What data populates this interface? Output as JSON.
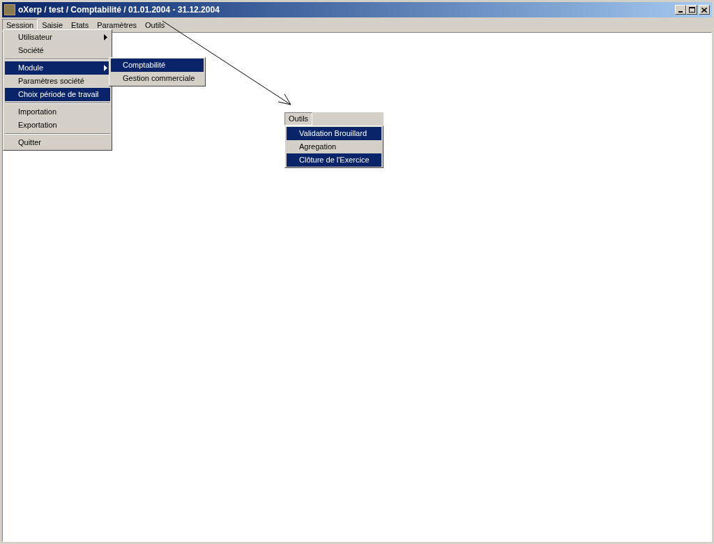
{
  "window": {
    "title": "oXerp / test / Comptabilité / 01.01.2004 - 31.12.2004"
  },
  "menu_bar": [
    {
      "label": "Session",
      "selected": true
    },
    {
      "label": "Saisie",
      "selected": false
    },
    {
      "label": "Etats",
      "selected": false
    },
    {
      "label": "Paramètres",
      "selected": false
    },
    {
      "label": "Outils",
      "selected": false
    }
  ],
  "session_menu": [
    {
      "kind": "item",
      "label": "Utilisateur",
      "has_submenu": true,
      "selected": false
    },
    {
      "kind": "item",
      "label": "Société",
      "has_submenu": false,
      "selected": false
    },
    {
      "kind": "separator"
    },
    {
      "kind": "item",
      "label": "Module",
      "has_submenu": true,
      "selected": true
    },
    {
      "kind": "item",
      "label": "Paramètres société",
      "has_submenu": false,
      "selected": false
    },
    {
      "kind": "item",
      "label": "Choix période de travail",
      "has_submenu": false,
      "selected": true
    },
    {
      "kind": "separator"
    },
    {
      "kind": "item",
      "label": "Importation",
      "has_submenu": false,
      "selected": false
    },
    {
      "kind": "item",
      "label": "Exportation",
      "has_submenu": false,
      "selected": false
    },
    {
      "kind": "separator"
    },
    {
      "kind": "item",
      "label": "Quitter",
      "has_submenu": false,
      "selected": false
    }
  ],
  "module_submenu": [
    {
      "label": "Comptabilité",
      "selected": true
    },
    {
      "label": "Gestion commerciale",
      "selected": false
    }
  ],
  "outils_callout": {
    "header": "Outils",
    "items": [
      {
        "label": "Validation Brouillard",
        "selected": true
      },
      {
        "label": "Agregation",
        "selected": false
      },
      {
        "label": "Clôture de l'Exercice",
        "selected": true
      }
    ]
  }
}
